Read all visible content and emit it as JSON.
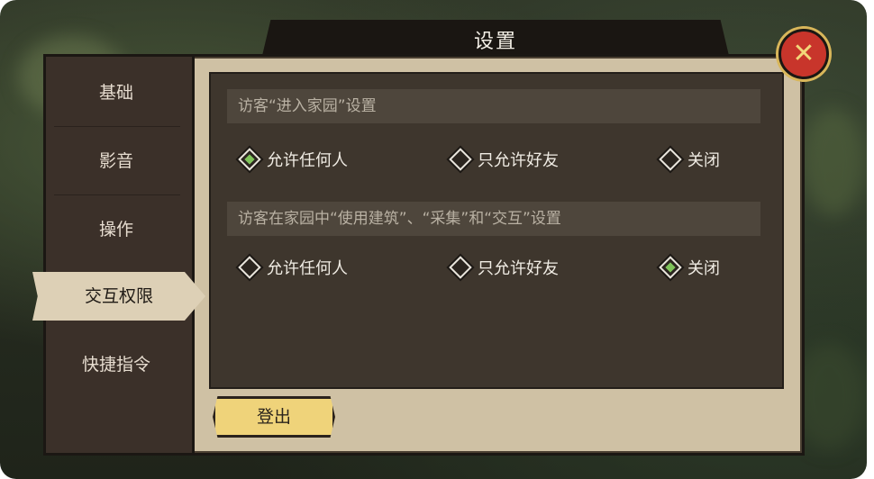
{
  "title": "设置",
  "close_icon": "close-x-icon",
  "sidebar": {
    "items": [
      {
        "label": "基础"
      },
      {
        "label": "影音"
      },
      {
        "label": "操作"
      },
      {
        "label": "交互权限"
      },
      {
        "label": "快捷指令"
      }
    ],
    "active_index": 3
  },
  "sections": [
    {
      "header": "访客“进入家园”设置",
      "options": [
        {
          "label": "允许任何人",
          "checked": true
        },
        {
          "label": "只允许好友",
          "checked": false
        },
        {
          "label": "关闭",
          "checked": false
        }
      ]
    },
    {
      "header": "访客在家园中“使用建筑”、“采集”和“交互”设置",
      "options": [
        {
          "label": "允许任何人",
          "checked": false
        },
        {
          "label": "只允许好友",
          "checked": false
        },
        {
          "label": "关闭",
          "checked": true
        }
      ]
    }
  ],
  "logout_label": "登出",
  "colors": {
    "accent_green": "#7fc35a",
    "logout_yellow": "#efd37a",
    "close_red": "#c8352b"
  }
}
